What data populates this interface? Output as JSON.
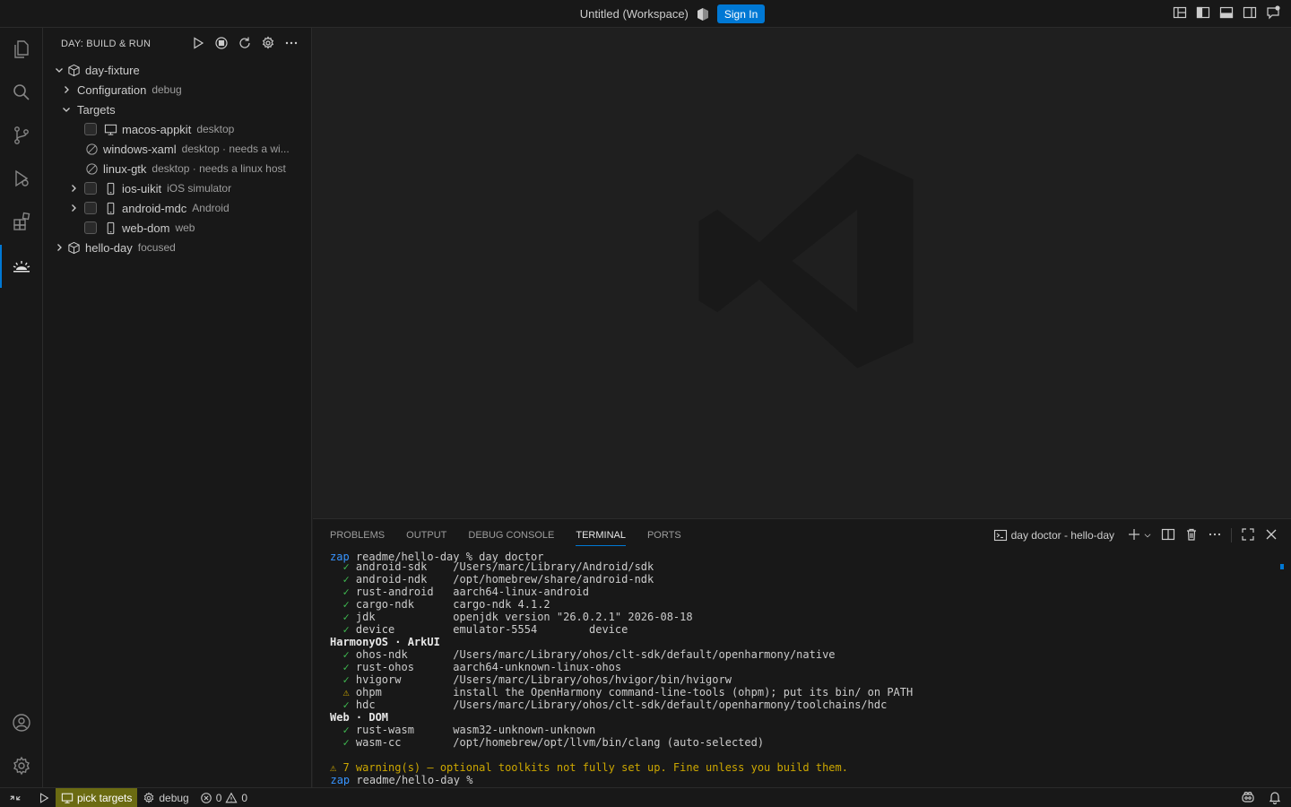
{
  "titlebar": {
    "title": "Untitled (Workspace)",
    "sign_in_label": "Sign In"
  },
  "activitybar": {
    "items": [
      "explorer-icon",
      "search-icon",
      "source-control-icon",
      "run-debug-icon",
      "extensions-icon",
      "day-build-icon"
    ],
    "bottom": [
      "account-icon",
      "gear-icon"
    ]
  },
  "sidebar": {
    "title": "DAY: BUILD & RUN",
    "tree": {
      "root1": {
        "label": "day-fixture"
      },
      "configuration": {
        "label": "Configuration",
        "desc": "debug"
      },
      "targets": {
        "label": "Targets"
      },
      "items": [
        {
          "label": "macos-appkit",
          "desc": "desktop"
        },
        {
          "label": "windows-xaml",
          "desc": "desktop · needs a wi..."
        },
        {
          "label": "linux-gtk",
          "desc": "desktop · needs a linux host"
        },
        {
          "label": "ios-uikit",
          "desc": "iOS simulator"
        },
        {
          "label": "android-mdc",
          "desc": "Android"
        },
        {
          "label": "web-dom",
          "desc": "web"
        }
      ],
      "root2": {
        "label": "hello-day",
        "desc": "focused"
      }
    }
  },
  "panel": {
    "tabs": [
      "PROBLEMS",
      "OUTPUT",
      "DEBUG CONSOLE",
      "TERMINAL",
      "PORTS"
    ],
    "active_tab": "TERMINAL",
    "terminal_name": "day doctor - hello-day",
    "terminal": {
      "prompt_user": "zap",
      "prompt_cmd": " readme/hello-day % day doctor",
      "lines": [
        {
          "mark": "✓",
          "name": "android-sdk",
          "value": "/Users/marc/Library/Android/sdk"
        },
        {
          "mark": "✓",
          "name": "android-ndk",
          "value": "/opt/homebrew/share/android-ndk"
        },
        {
          "mark": "✓",
          "name": "rust-android",
          "value": "aarch64-linux-android"
        },
        {
          "mark": "✓",
          "name": "cargo-ndk",
          "value": "cargo-ndk 4.1.2"
        },
        {
          "mark": "✓",
          "name": "jdk",
          "value": "openjdk version \"26.0.2.1\" 2026-08-18"
        },
        {
          "mark": "✓",
          "name": "device",
          "value": "emulator-5554        device"
        }
      ],
      "harmony_head": "HarmonyOS · ArkUI",
      "harmony": [
        {
          "mark": "✓",
          "name": "ohos-ndk",
          "value": "/Users/marc/Library/ohos/clt-sdk/default/openharmony/native"
        },
        {
          "mark": "✓",
          "name": "rust-ohos",
          "value": "aarch64-unknown-linux-ohos"
        },
        {
          "mark": "✓",
          "name": "hvigorw",
          "value": "/Users/marc/Library/ohos/hvigor/bin/hvigorw"
        },
        {
          "mark": "⚠",
          "name": "ohpm",
          "value": "install the OpenHarmony command-line-tools (ohpm); put its bin/ on PATH"
        },
        {
          "mark": "✓",
          "name": "hdc",
          "value": "/Users/marc/Library/ohos/clt-sdk/default/openharmony/toolchains/hdc"
        }
      ],
      "web_head": "Web · DOM",
      "web": [
        {
          "mark": "✓",
          "name": "rust-wasm",
          "value": "wasm32-unknown-unknown"
        },
        {
          "mark": "✓",
          "name": "wasm-cc",
          "value": "/opt/homebrew/opt/llvm/bin/clang (auto-selected)"
        }
      ],
      "summary": "⚠ 7 warning(s) — optional toolkits not fully set up. Fine unless you build them.",
      "final_prompt_user": "zap",
      "final_prompt_cmd": " readme/hello-day % ",
      "final_marker": "○"
    }
  },
  "statusbar": {
    "pick_targets": "pick targets",
    "debug": "debug",
    "errors": "0",
    "warnings": "0"
  },
  "colors": {
    "accent": "#0078d4",
    "ok": "#3fb950",
    "warn": "#cca700"
  }
}
